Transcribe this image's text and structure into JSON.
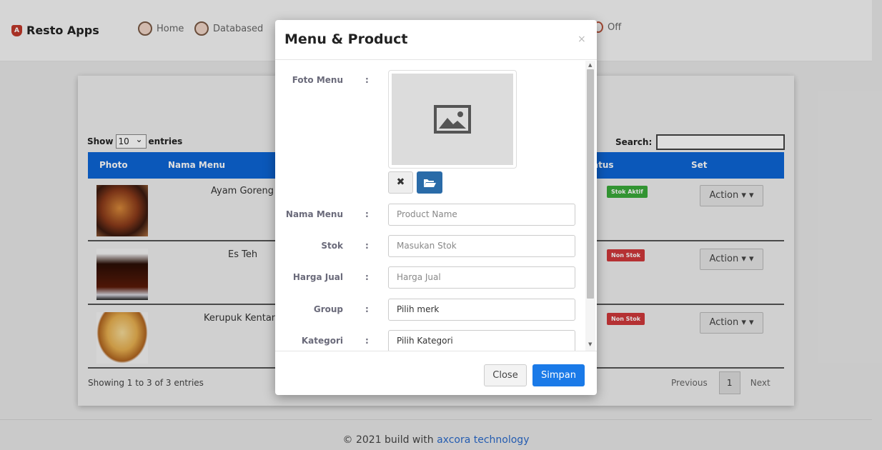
{
  "navbar": {
    "brand": "Resto Apps",
    "links": [
      {
        "label": "Home",
        "icon": "chef-icon"
      },
      {
        "label": "Databased",
        "icon": "dish-icon"
      },
      {
        "label": "Off",
        "icon": "power-icon"
      }
    ]
  },
  "table": {
    "show_label": "Show",
    "show_value": "10",
    "entries_label": "entries",
    "search_label": "Search:",
    "headers": {
      "photo": "Photo",
      "name": "Nama Menu",
      "status": "atus",
      "set": "Set"
    },
    "rows": [
      {
        "name": "Ayam Goreng",
        "status": "Stok Aktif",
        "action": "Action"
      },
      {
        "name": "Es Teh",
        "status": "Non Stok",
        "action": "Action"
      },
      {
        "name": "Kerupuk Kentan",
        "status": "Non Stok",
        "action": "Action"
      }
    ],
    "info": "Showing 1 to 3 of 3 entries",
    "pager": {
      "prev": "Previous",
      "page": "1",
      "next": "Next"
    }
  },
  "footer": {
    "text": "© 2021 build with",
    "link": "axcora technology"
  },
  "modal": {
    "title": "Menu & Product",
    "close_symbol": "×",
    "fields": {
      "photo_label": "Foto Menu",
      "colon": ":",
      "name_label": "Nama Menu",
      "name_placeholder": "Product Name",
      "stock_label": "Stok",
      "stock_placeholder": "Masukan Stok",
      "price_label": "Harga Jual",
      "price_placeholder": "Harga Jual",
      "group_label": "Group",
      "group_value": "Pilih merk",
      "category_label": "Kategori",
      "category_value": "Pilih Kategori"
    },
    "buttons": {
      "remove": "✖",
      "close": "Close",
      "save": "Simpan"
    }
  },
  "colors": {
    "primary": "#0d66d6",
    "save": "#1a7ae8",
    "stock_active": "#3aaa3a",
    "stock_none": "#d0393b"
  }
}
